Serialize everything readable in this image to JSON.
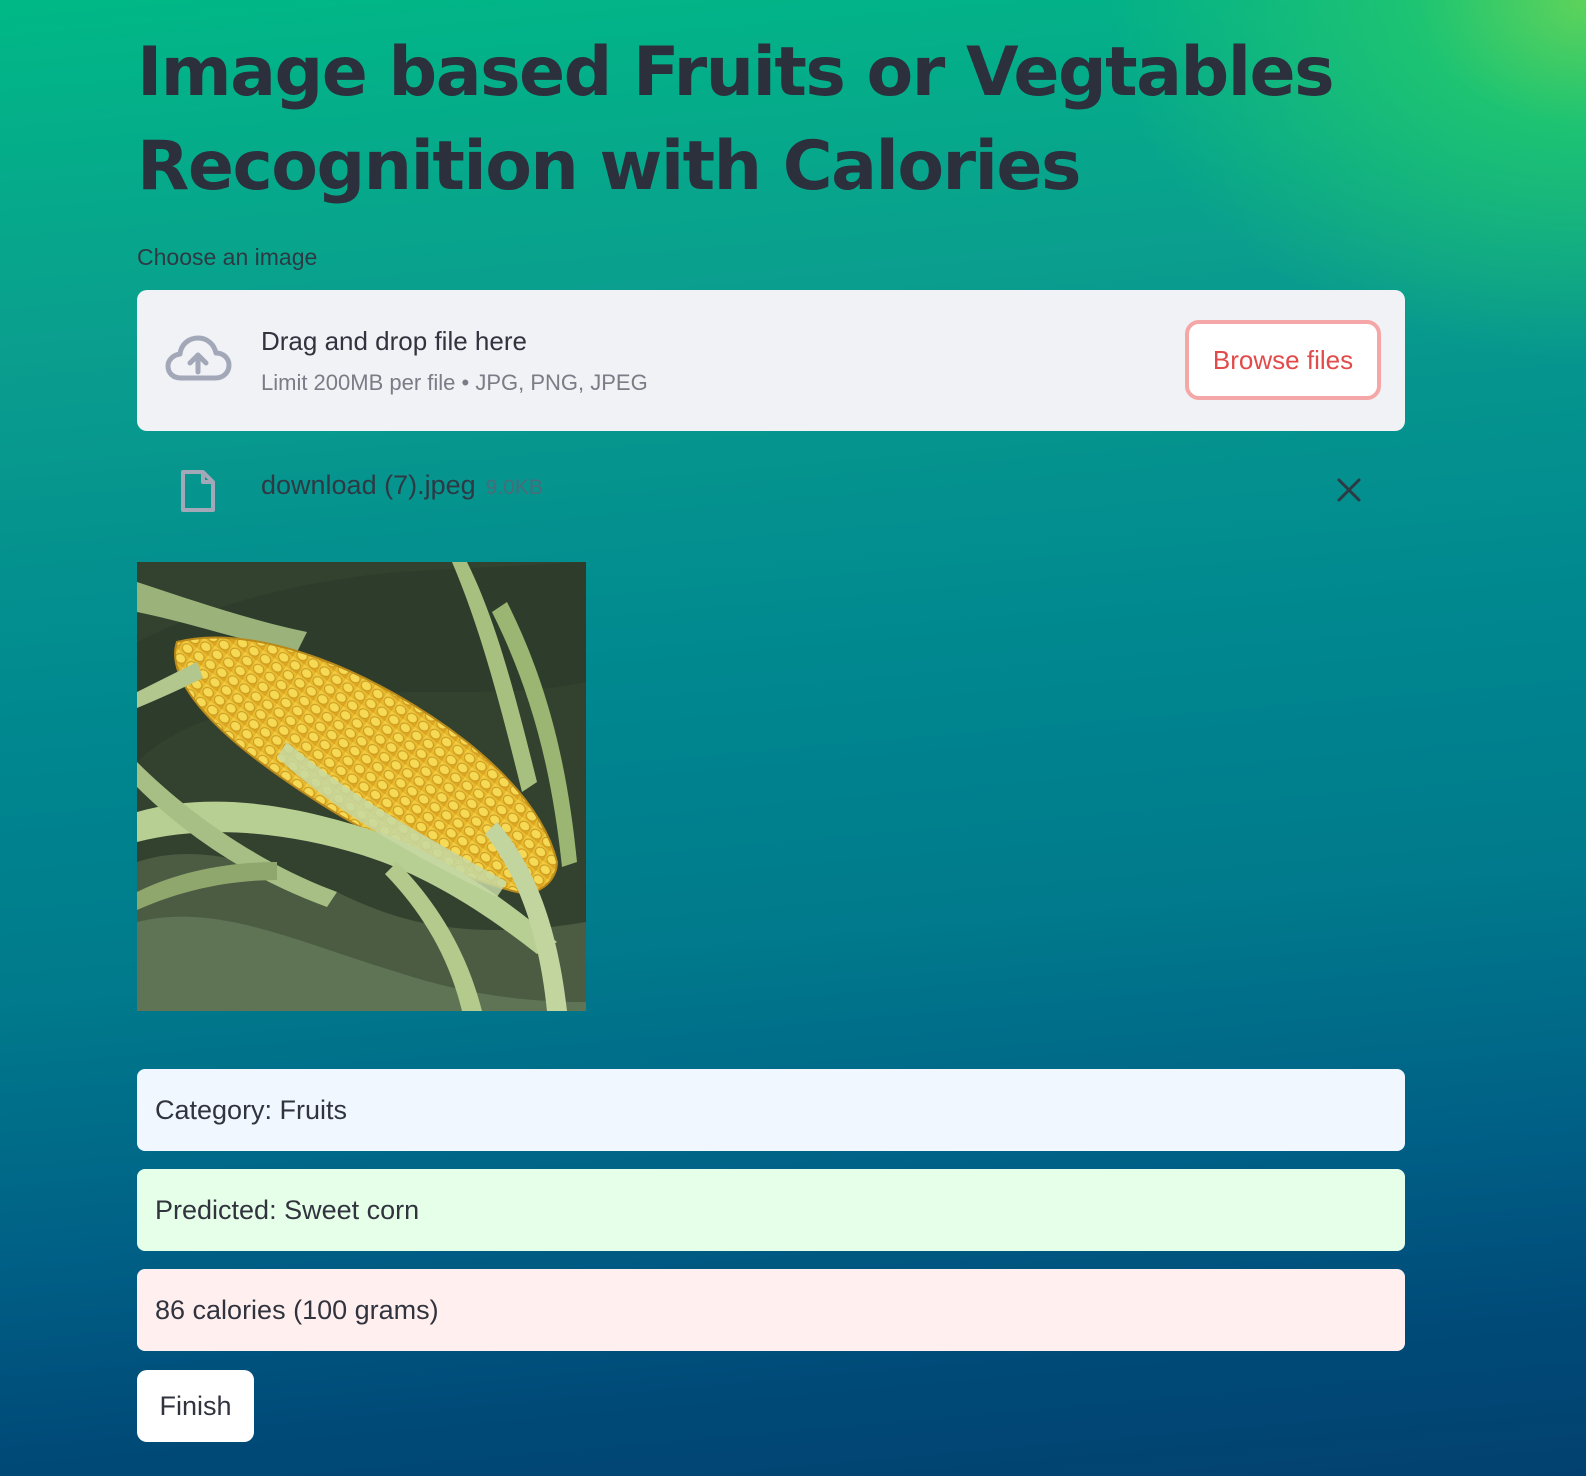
{
  "page": {
    "title": "Image based Fruits or Vegtables Recognition with Calories"
  },
  "uploader": {
    "label": "Choose an image",
    "drop_title": "Drag and drop file here",
    "drop_subtitle": "Limit 200MB per file • JPG, PNG, JPEG",
    "browse_label": "Browse files",
    "icon": "cloud-upload-icon"
  },
  "uploaded_file": {
    "name": "download (7).jpeg",
    "size": "9.0KB",
    "icon": "file-icon",
    "remove_icon": "close-icon"
  },
  "results": {
    "category": "Category: Fruits",
    "predicted": "Predicted: Sweet corn",
    "calories": "86 calories (100 grams)"
  },
  "actions": {
    "finish_label": "Finish"
  },
  "colors": {
    "browse_text": "#e34a4a",
    "browse_border": "#f5a6a6",
    "info_bg": "#f0f7ff",
    "success_bg": "#e6ffe8",
    "error_bg": "#fff0ef"
  }
}
